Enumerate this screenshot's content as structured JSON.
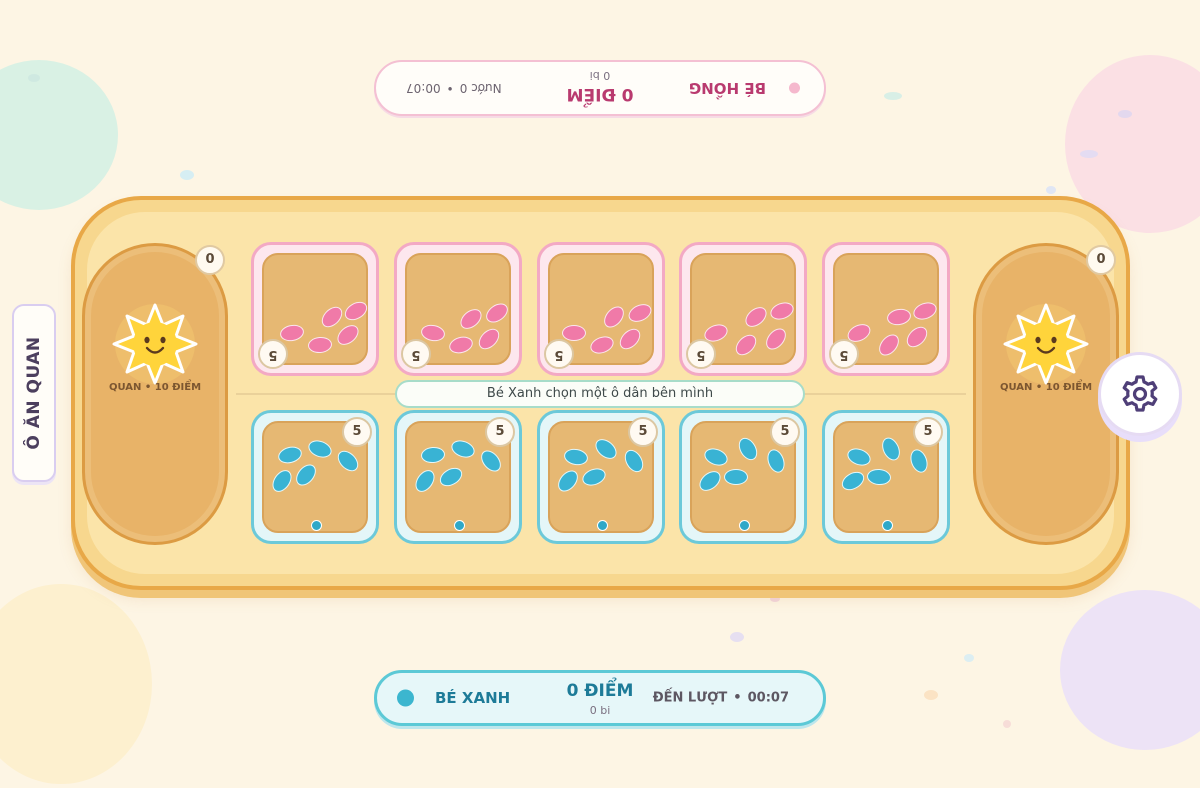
{
  "game_title": "Ô ĂN QUAN",
  "top_player": {
    "name": "BÉ HỒNG",
    "score": "0 ĐIỂM",
    "seeds": "0 bi",
    "moves": "Nước 0",
    "timer": "00:07",
    "color": "#f07aa8"
  },
  "bottom_player": {
    "name": "BÉ XANH",
    "score": "0 ĐIỂM",
    "seeds": "0 bi",
    "turn": "ĐẾN LƯỢT",
    "timer": "00:07",
    "color": "#39b3d4"
  },
  "status_message": "Bé Xanh chọn một ô dân bên mình",
  "quan": {
    "left": {
      "label": "QUAN • 10 ĐIỂM",
      "count": "0",
      "icon": "sun-icon"
    },
    "right": {
      "label": "QUAN • 10 ĐIỂM",
      "count": "0",
      "icon": "sun-icon"
    }
  },
  "pink_pits": [
    "5",
    "5",
    "5",
    "5",
    "5"
  ],
  "blue_pits": [
    "5",
    "5",
    "5",
    "5",
    "5"
  ],
  "settings_icon": "gear-icon"
}
